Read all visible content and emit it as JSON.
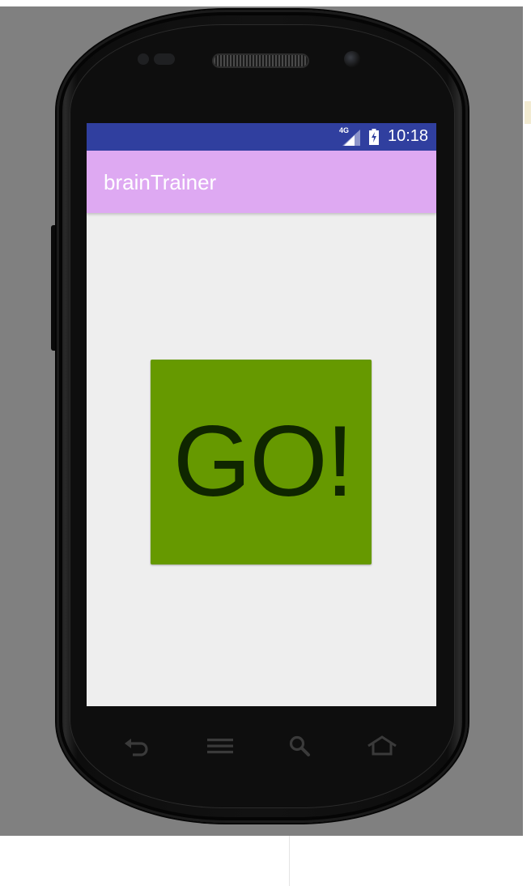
{
  "status_bar": {
    "network": "4G",
    "time": "10:18"
  },
  "app_bar": {
    "title": "brainTrainer"
  },
  "main": {
    "go_button_label": "GO!"
  },
  "colors": {
    "status_bar": "#303f9f",
    "app_bar": "#dea9f2",
    "screen_background": "#eeeeee",
    "go_button": "#669900",
    "go_text": "#0f2600"
  },
  "nav_bar": {
    "buttons": [
      "back-icon",
      "menu-icon",
      "search-icon",
      "home-icon"
    ]
  }
}
